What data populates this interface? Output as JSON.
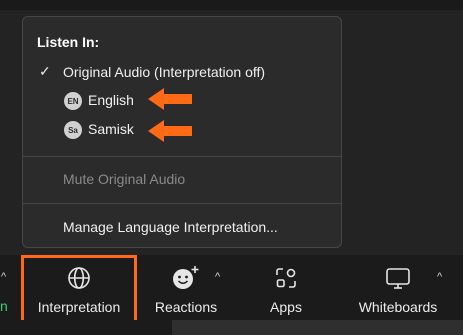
{
  "menu": {
    "header": "Listen In:",
    "items": [
      {
        "label": "Original Audio (Interpretation off)",
        "checked": true
      },
      {
        "label": "English",
        "badge": "EN"
      },
      {
        "label": "Samisk",
        "badge": "Sa"
      }
    ],
    "mute_label": "Mute Original Audio",
    "manage_label": "Manage Language Interpretation..."
  },
  "toolbar": {
    "left_fragment": "n",
    "caret_symbol": "^",
    "items": [
      {
        "label": "Interpretation",
        "icon": "globe-icon"
      },
      {
        "label": "Reactions",
        "icon": "emoji-add-icon"
      },
      {
        "label": "Apps",
        "icon": "apps-icon"
      },
      {
        "label": "Whiteboards",
        "icon": "whiteboard-icon"
      }
    ]
  },
  "colors": {
    "accent": "#ff6a14",
    "menu_bg": "#2b2b2b",
    "toolbar_bg": "#1b1b1b"
  }
}
